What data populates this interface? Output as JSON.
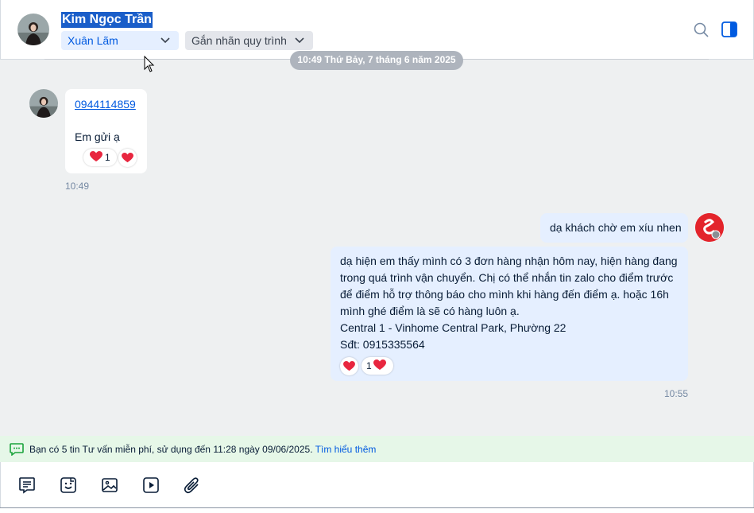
{
  "header": {
    "contact_name": "Kim Ngọc Trần",
    "tag": "Xuân Lãm",
    "label_placeholder": "Gắn nhãn quy trình"
  },
  "date_separator": "10:49 Thứ Bảy, 7 tháng 6 năm 2025",
  "incoming": {
    "phone": "0944114859",
    "text": "Em gửi ạ",
    "reaction_count": "1",
    "time": "10:49"
  },
  "outgoing": {
    "message1": "dạ khách chờ em xíu nhen",
    "message2_lines": [
      "dạ hiện em thấy mình có 3 đơn hàng nhận hôm nay, hiện hàng đang",
      "trong quá trình vận chuyển. Chị có thể nhắn tin zalo cho điểm trước",
      "để điểm hỗ trợ thông báo cho mình khi hàng đến điểm ạ. hoặc 16h",
      "mình ghé điểm là sẽ có hàng luôn ạ.",
      "Central 1 - Vinhome Central Park, Phường 22",
      "Sđt: 0915335564"
    ],
    "reaction_count": "1",
    "time": "10:55"
  },
  "notice": {
    "text": "Bạn có 5 tin Tư vấn miễn phí, sử dụng đến 11:28 ngày 09/06/2025.",
    "link": "Tìm hiểu thêm"
  },
  "colors": {
    "accent": "#005ae0",
    "bubble_out": "#e5efff",
    "heart": "#e8263f",
    "notice_bg": "#e6f7e8"
  },
  "icons": [
    "search-icon",
    "panel-toggle-icon",
    "heart-icon",
    "message-icon",
    "sticker-icon",
    "image-icon",
    "video-icon",
    "attachment-icon",
    "chat-icon"
  ]
}
